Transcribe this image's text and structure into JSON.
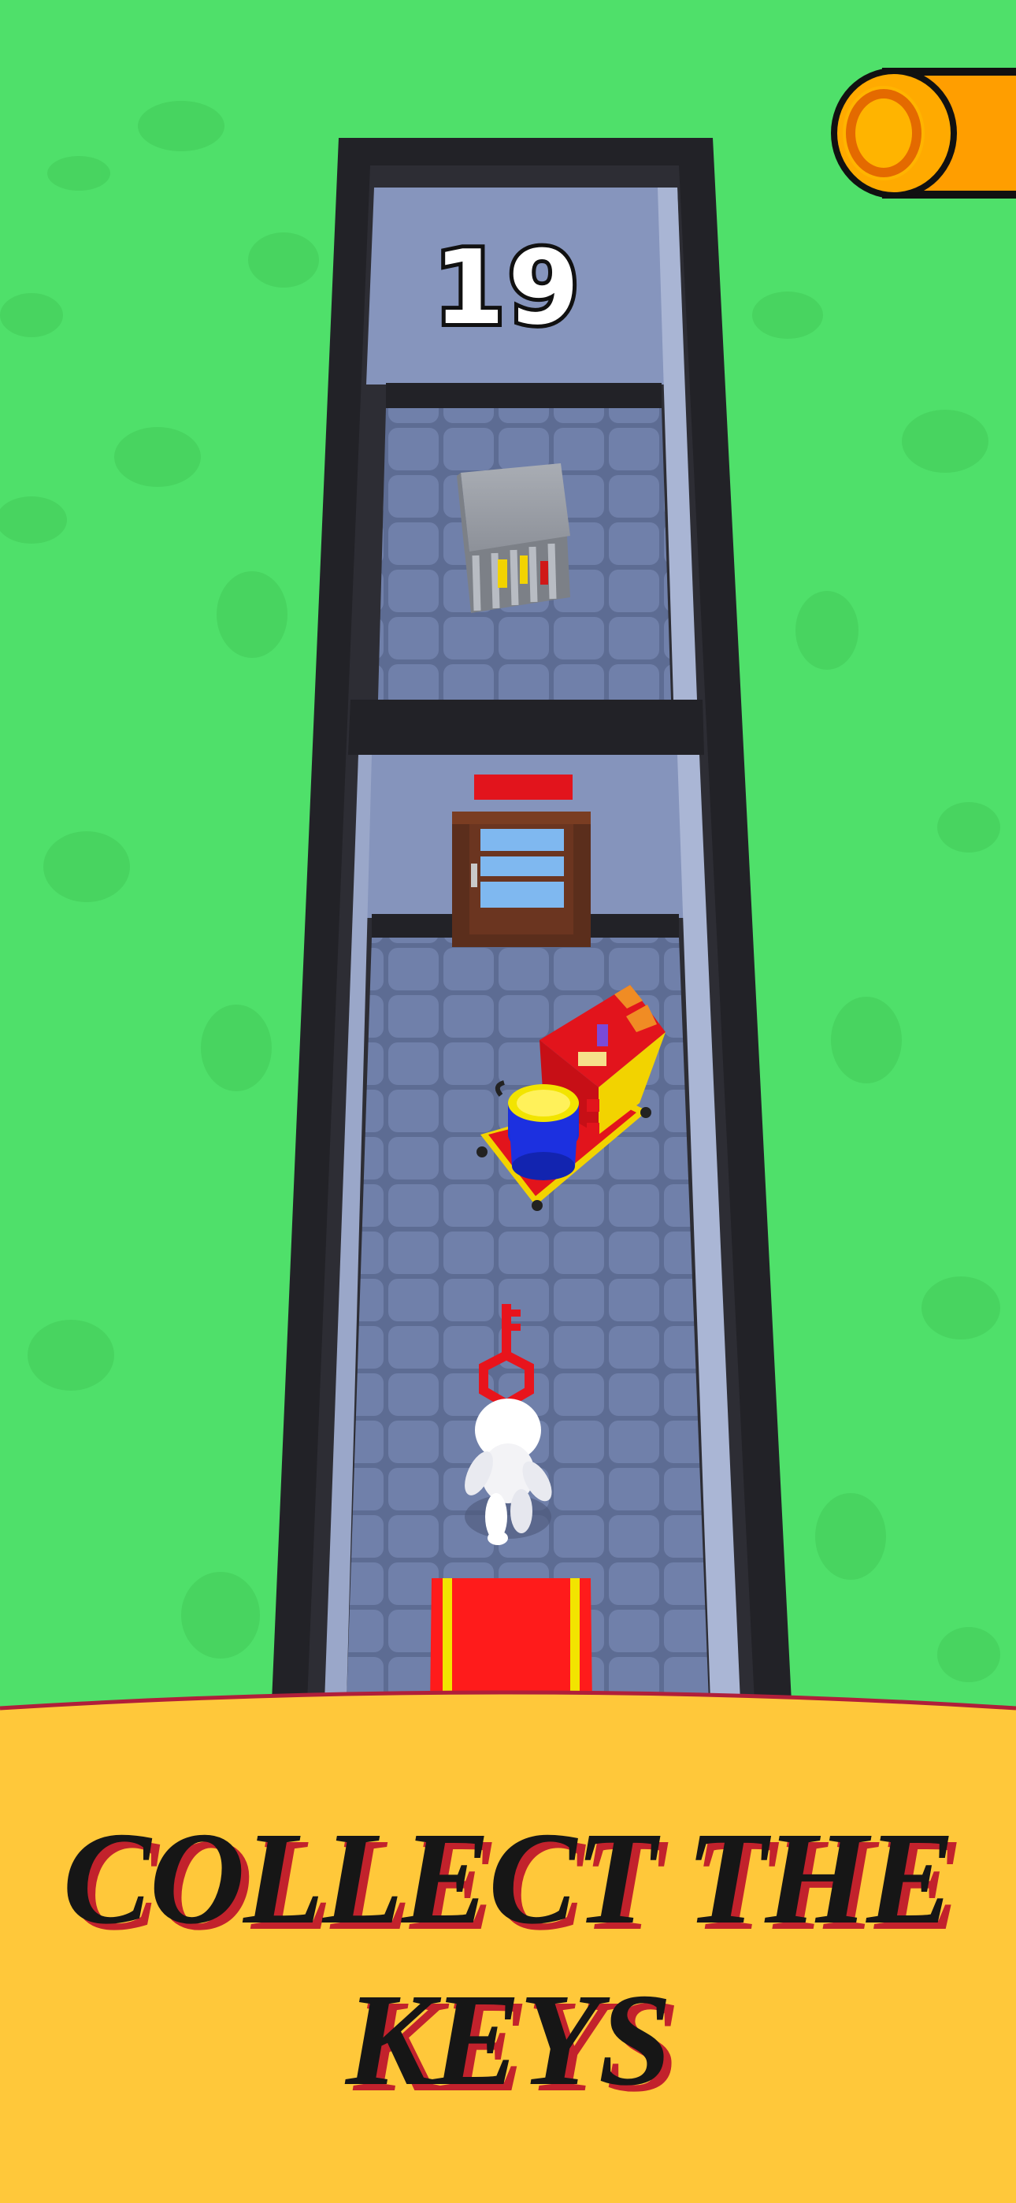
{
  "hud": {
    "level_number": "19",
    "coin_icon": "coin-icon"
  },
  "banner": {
    "line1": "COLLECT THE",
    "line2": "KEYS"
  },
  "colors": {
    "grass": "#4fe06a",
    "wall": "#222227",
    "floor": "#6d7fa8",
    "banner": "#ffc83a",
    "banner_shadow_text": "#c2222c",
    "key": "#e8141c",
    "carpet": "#ff1b1b",
    "coin": "#ffb000"
  },
  "scene": {
    "icons": [
      "coin-icon",
      "cage-icon",
      "door-icon",
      "cart-icon",
      "key-icon",
      "player-icon",
      "carpet-icon"
    ]
  }
}
